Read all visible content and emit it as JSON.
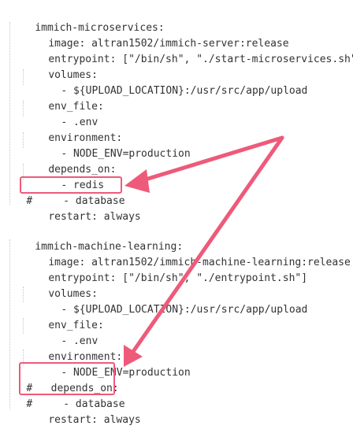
{
  "lines": [
    {
      "id": "svc1-key",
      "tokens": [
        {
          "cls": "k",
          "text": "immich-microservices"
        },
        {
          "cls": "p",
          "text": ":"
        }
      ]
    },
    {
      "id": "svc1-image",
      "tokens": [
        {
          "cls": "k",
          "text": "image"
        },
        {
          "cls": "p",
          "text": ": "
        },
        {
          "cls": "v",
          "text": "altran1502/immich-server:release"
        }
      ]
    },
    {
      "id": "svc1-entrypoint",
      "tokens": [
        {
          "cls": "k",
          "text": "entrypoint"
        },
        {
          "cls": "p",
          "text": ": ["
        },
        {
          "cls": "s",
          "text": "\"/bin/sh\""
        },
        {
          "cls": "p",
          "text": ", "
        },
        {
          "cls": "s",
          "text": "\"./start-microservices.sh\""
        },
        {
          "cls": "p",
          "text": "]"
        }
      ]
    },
    {
      "id": "svc1-volumes",
      "tokens": [
        {
          "cls": "k",
          "text": "volumes"
        },
        {
          "cls": "p",
          "text": ":"
        }
      ]
    },
    {
      "id": "svc1-volume-item",
      "tokens": [
        {
          "cls": "p",
          "text": "- "
        },
        {
          "cls": "v",
          "text": "${UPLOAD_LOCATION}:/usr/src/app/upload"
        }
      ]
    },
    {
      "id": "svc1-env-file",
      "tokens": [
        {
          "cls": "k",
          "text": "env_file"
        },
        {
          "cls": "p",
          "text": ":"
        }
      ]
    },
    {
      "id": "svc1-env-file-item",
      "tokens": [
        {
          "cls": "p",
          "text": "- "
        },
        {
          "cls": "v",
          "text": ".env"
        }
      ]
    },
    {
      "id": "svc1-environment",
      "tokens": [
        {
          "cls": "k",
          "text": "environment"
        },
        {
          "cls": "p",
          "text": ":"
        }
      ]
    },
    {
      "id": "svc1-environment-item",
      "tokens": [
        {
          "cls": "p",
          "text": "- "
        },
        {
          "cls": "v",
          "text": "NODE_ENV=production"
        }
      ]
    },
    {
      "id": "svc1-depends-on",
      "tokens": [
        {
          "cls": "k",
          "text": "depends_on"
        },
        {
          "cls": "p",
          "text": ":"
        }
      ]
    },
    {
      "id": "svc1-depends-redis",
      "tokens": [
        {
          "cls": "p",
          "text": "- "
        },
        {
          "cls": "v",
          "text": "redis"
        }
      ]
    },
    {
      "id": "svc1-depends-database-commented",
      "tokens": [
        {
          "cls": "c",
          "text": "#     - database"
        }
      ]
    },
    {
      "id": "svc1-restart",
      "tokens": [
        {
          "cls": "k",
          "text": "restart"
        },
        {
          "cls": "p",
          "text": ": "
        },
        {
          "cls": "v",
          "text": "always"
        }
      ]
    },
    {
      "id": "svc2-key",
      "tokens": [
        {
          "cls": "k",
          "text": "immich-machine-learning"
        },
        {
          "cls": "p",
          "text": ":"
        }
      ]
    },
    {
      "id": "svc2-image",
      "tokens": [
        {
          "cls": "k",
          "text": "image"
        },
        {
          "cls": "p",
          "text": ": "
        },
        {
          "cls": "v",
          "text": "altran1502/immich-machine-learning:release"
        }
      ]
    },
    {
      "id": "svc2-entrypoint",
      "tokens": [
        {
          "cls": "k",
          "text": "entrypoint"
        },
        {
          "cls": "p",
          "text": ": ["
        },
        {
          "cls": "s",
          "text": "\"/bin/sh\""
        },
        {
          "cls": "p",
          "text": ", "
        },
        {
          "cls": "s",
          "text": "\"./entrypoint.sh\""
        },
        {
          "cls": "p",
          "text": "]"
        }
      ]
    },
    {
      "id": "svc2-volumes",
      "tokens": [
        {
          "cls": "k",
          "text": "volumes"
        },
        {
          "cls": "p",
          "text": ":"
        }
      ]
    },
    {
      "id": "svc2-volume-item",
      "tokens": [
        {
          "cls": "p",
          "text": "- "
        },
        {
          "cls": "v",
          "text": "${UPLOAD_LOCATION}:/usr/src/app/upload"
        }
      ]
    },
    {
      "id": "svc2-env-file",
      "tokens": [
        {
          "cls": "k",
          "text": "env_file"
        },
        {
          "cls": "p",
          "text": ":"
        }
      ]
    },
    {
      "id": "svc2-env-file-item",
      "tokens": [
        {
          "cls": "p",
          "text": "- "
        },
        {
          "cls": "v",
          "text": ".env"
        }
      ]
    },
    {
      "id": "svc2-environment",
      "tokens": [
        {
          "cls": "k",
          "text": "environment"
        },
        {
          "cls": "p",
          "text": ":"
        }
      ]
    },
    {
      "id": "svc2-environment-item",
      "tokens": [
        {
          "cls": "p",
          "text": "- "
        },
        {
          "cls": "v",
          "text": "NODE_ENV=production"
        }
      ]
    },
    {
      "id": "svc2-depends-on-commented",
      "tokens": [
        {
          "cls": "c",
          "text": "#   depends_on:"
        }
      ]
    },
    {
      "id": "svc2-depends-database-commented",
      "tokens": [
        {
          "cls": "c",
          "text": "#     - database"
        }
      ]
    },
    {
      "id": "svc2-restart",
      "tokens": [
        {
          "cls": "k",
          "text": "restart"
        },
        {
          "cls": "p",
          "text": ": "
        },
        {
          "cls": "v",
          "text": "always"
        }
      ]
    }
  ],
  "colors": {
    "key": "#b8006a",
    "string": "#1a1aa6",
    "comment": "#9a9a9a",
    "text": "#222222",
    "highlight": "#ee5a7a"
  }
}
